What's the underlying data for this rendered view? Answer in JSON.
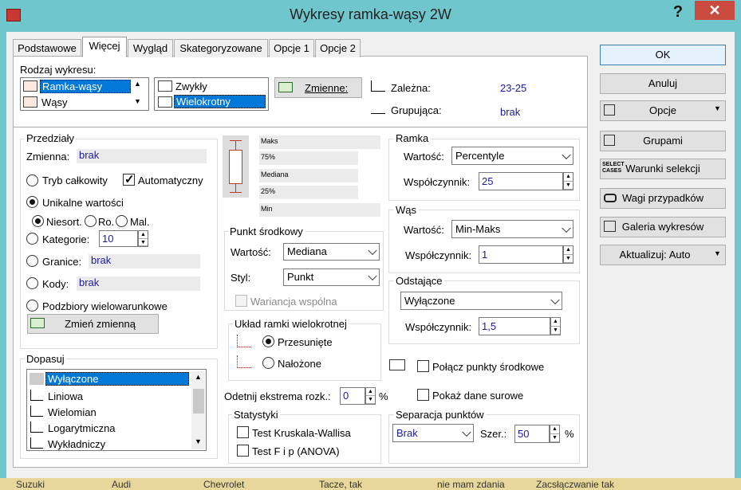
{
  "window": {
    "title": "Wykresy ramka-wąsy 2W",
    "help": "?",
    "close": "✕"
  },
  "tabs": [
    "Podstawowe",
    "Więcej",
    "Wygląd",
    "Skategoryzowane",
    "Opcje 1",
    "Opcje 2"
  ],
  "rodzaj": {
    "label": "Rodzaj wykresu:",
    "items": [
      "Ramka-wąsy",
      "Wąsy"
    ],
    "types": [
      "Zwykły",
      "Wielokrotny"
    ]
  },
  "zmienne_btn": "Zmienne:",
  "zalezna": {
    "label": "Zależna:",
    "value": "23-25"
  },
  "grupujaca": {
    "label": "Grupująca:",
    "value": "brak"
  },
  "buttons": {
    "ok": "OK",
    "anuluj": "Anuluj",
    "opcje": "Opcje",
    "grupami": "Grupami",
    "warunki": "Warunki selekcji",
    "wagi": "Wagi przypadków",
    "galeria": "Galeria wykresów",
    "aktualizuj": "Aktualizuj: Auto"
  },
  "przedzialy": {
    "title": "Przedziały",
    "zmienna_label": "Zmienna:",
    "zmienna_value": "brak",
    "tryb": "Tryb całkowity",
    "auto": "Automatyczny",
    "unikalne": "Unikalne wartości",
    "niesort": "Niesort.",
    "ro": "Ro.",
    "mal": "Mal.",
    "kategorie": "Kategorie:",
    "kategorie_value": "10",
    "granice": "Granice:",
    "granice_value": "brak",
    "kody": "Kody:",
    "kody_value": "brak",
    "podzbiory": "Podzbiory wielowarunkowe",
    "zmien": "Zmień zmienną"
  },
  "preview": {
    "maks": "Maks",
    "p75": "75%",
    "mediana": "Mediana",
    "p25": "25%",
    "min": "Min"
  },
  "punkt": {
    "title": "Punkt środkowy",
    "wartosc_label": "Wartość:",
    "wartosc": "Mediana",
    "styl_label": "Styl:",
    "styl": "Punkt",
    "wariancja": "Wariancja wspólna"
  },
  "uklad": {
    "title": "Układ ramki wielokrotnej",
    "przesuniete": "Przesunięte",
    "nalozone": "Nałożone"
  },
  "odetnij": {
    "label": "Odetnij ekstrema rozk.:",
    "value": "0",
    "unit": "%"
  },
  "statystyki": {
    "title": "Statystyki",
    "kw": "Test Kruskala-Wallisa",
    "anova": "Test F i p (ANOVA)"
  },
  "ramka": {
    "title": "Ramka",
    "wartosc_label": "Wartość:",
    "wartosc": "Percentyle",
    "wsp_label": "Współczynnik:",
    "wsp": "25"
  },
  "was": {
    "title": "Wąs",
    "wartosc_label": "Wartość:",
    "wartosc": "Min-Maks",
    "wsp_label": "Współczynnik:",
    "wsp": "1"
  },
  "odstajace": {
    "title": "Odstające",
    "wartosc": "Wyłączone",
    "wsp_label": "Współczynnik:",
    "wsp": "1,5"
  },
  "polacz": "Połącz punkty środkowe",
  "pokaz": "Pokaż dane surowe",
  "separacja": {
    "title": "Separacja punktów",
    "value": "Brak",
    "szer_label": "Szer.:",
    "szer": "50",
    "unit": "%"
  },
  "dopasuj": {
    "title": "Dopasuj",
    "items": [
      "Wyłączone",
      "Liniowa",
      "Wielomian",
      "Logarytmiczna",
      "Wykładniczy"
    ]
  },
  "bottom": [
    "Suzuki",
    "Audi",
    "Chevrolet",
    "Tacze, tak",
    "nie mam zdania",
    "Zacsłączwanie tak"
  ]
}
